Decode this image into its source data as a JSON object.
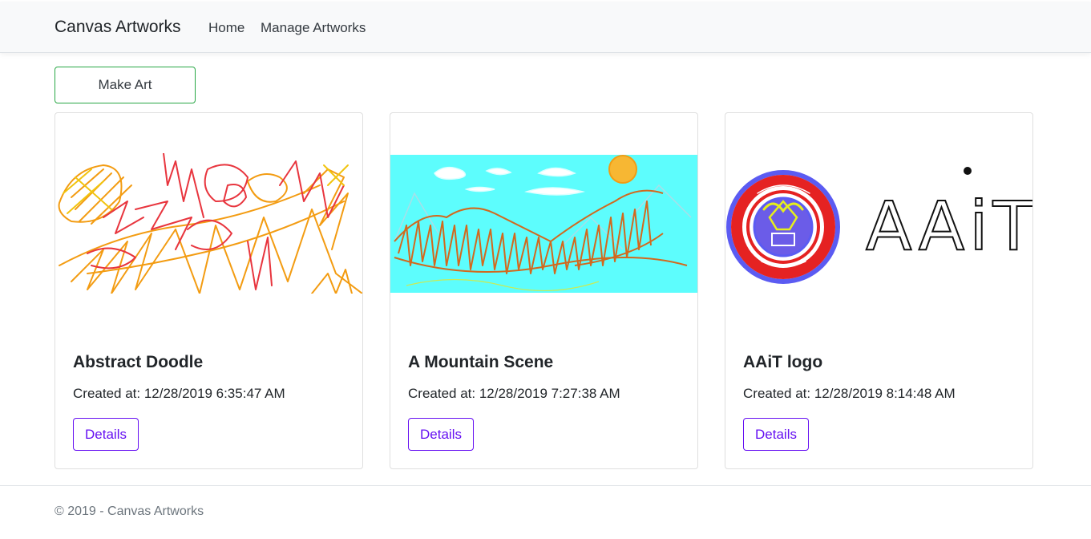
{
  "nav": {
    "brand": "Canvas Artworks",
    "links": [
      "Home",
      "Manage Artworks"
    ]
  },
  "actions": {
    "make_art_label": "Make Art"
  },
  "artworks": [
    {
      "title": "Abstract Doodle",
      "created": "Created at: 12/28/2019 6:35:47 AM",
      "details_label": "Details"
    },
    {
      "title": "A Mountain Scene",
      "created": "Created at: 12/28/2019 7:27:38 AM",
      "details_label": "Details"
    },
    {
      "title": "AAiT logo",
      "created": "Created at: 12/28/2019 8:14:48 AM",
      "details_label": "Details"
    }
  ],
  "logo_text": "AAiT",
  "footer": {
    "text": "© 2019 - Canvas Artworks"
  },
  "colors": {
    "make_art_border": "#28a745",
    "details_accent": "#6610f2",
    "navbar_bg": "#f8f9fa"
  }
}
